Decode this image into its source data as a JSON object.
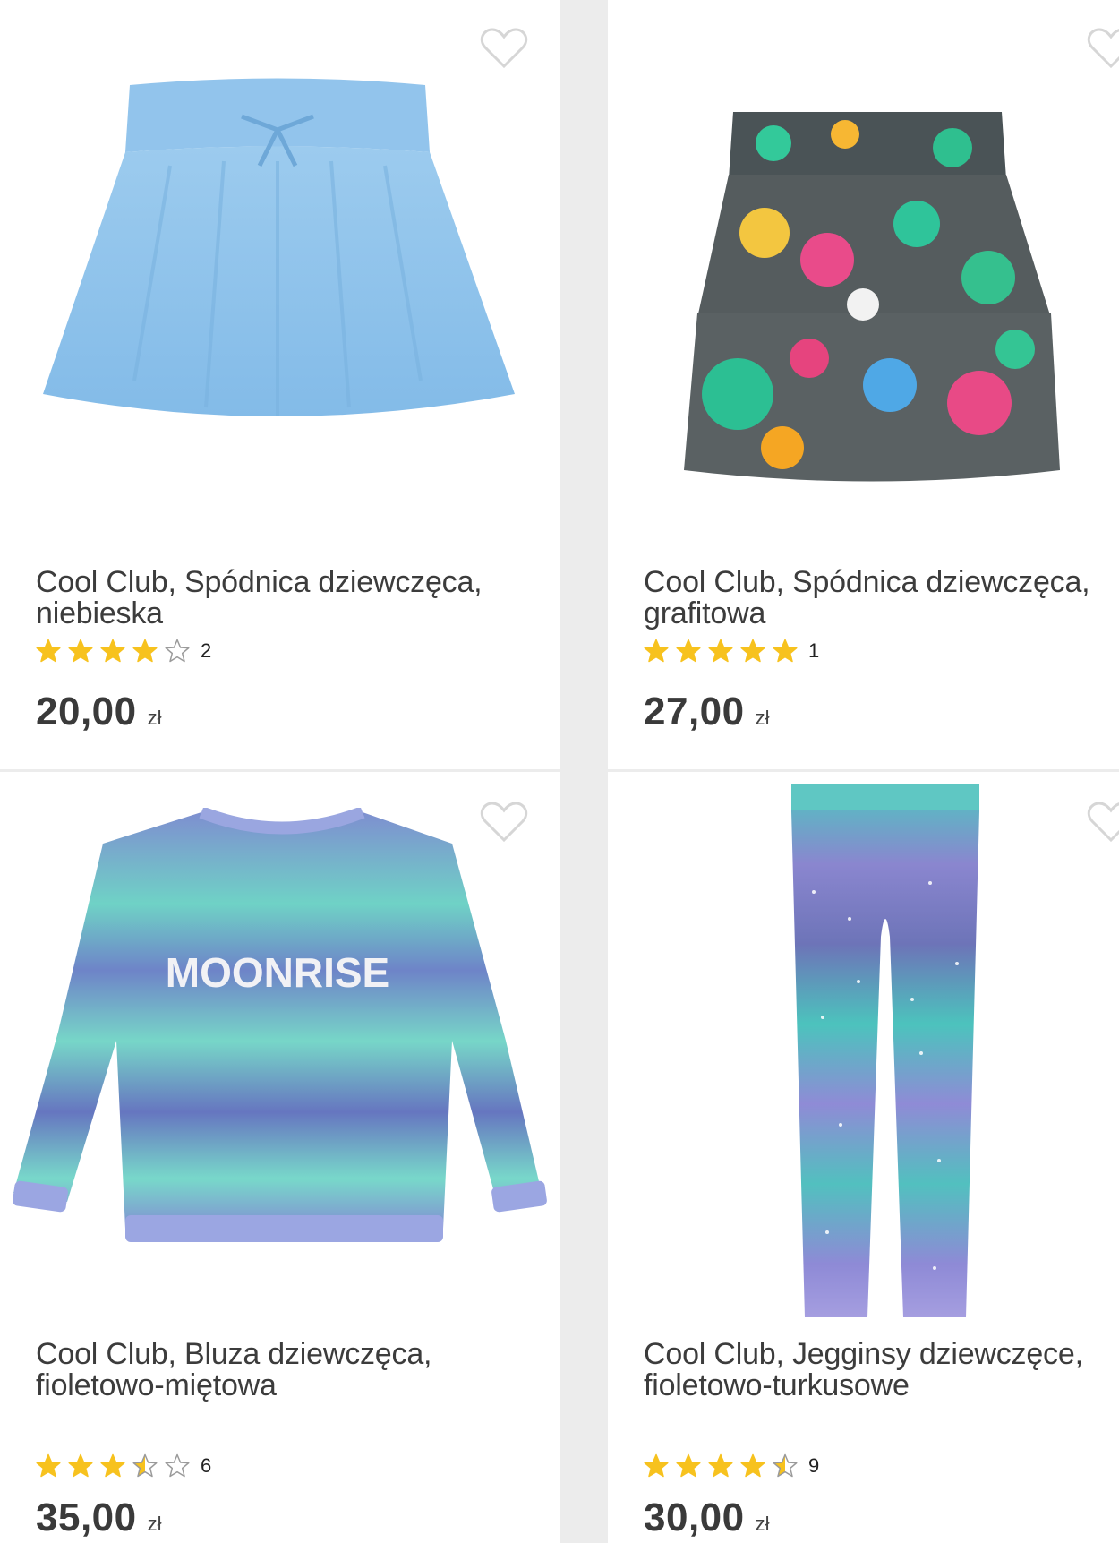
{
  "products": [
    {
      "title_line1": "Cool Club, Spódnica dziewczęca,",
      "title_line2": "niebieska",
      "rating": 4,
      "reviews": "2",
      "price": "20,00",
      "currency": "zł",
      "image": "light-blue-skirt",
      "wishlist_icon": "heart-outline-icon"
    },
    {
      "title_line1": "Cool Club, Spódnica dziewczęca,",
      "title_line2": "grafitowa",
      "rating": 5,
      "reviews": "1",
      "price": "27,00",
      "currency": "zł",
      "image": "graphite-floral-skirt",
      "wishlist_icon": "heart-outline-icon"
    },
    {
      "title_line1": "Cool Club, Bluza dziewczęca,",
      "title_line2": "fioletowo-miętowa",
      "rating": 3.5,
      "reviews": "6",
      "price": "35,00",
      "currency": "zł",
      "image": "sweatshirt",
      "print_text": "MOONRISE",
      "wishlist_icon": "heart-outline-icon"
    },
    {
      "title_line1": "Cool Club, Jegginsy dziewczęce,",
      "title_line2": "fioletowo-turkusowe",
      "rating": 4.5,
      "reviews": "9",
      "price": "30,00",
      "currency": "zł",
      "image": "galaxy-jeggings",
      "wishlist_icon": "heart-outline-icon"
    }
  ],
  "colors": {
    "star": "#f7c21e",
    "star_empty_stroke": "#9a9a9a",
    "heart_stroke": "#d6d6d6"
  }
}
